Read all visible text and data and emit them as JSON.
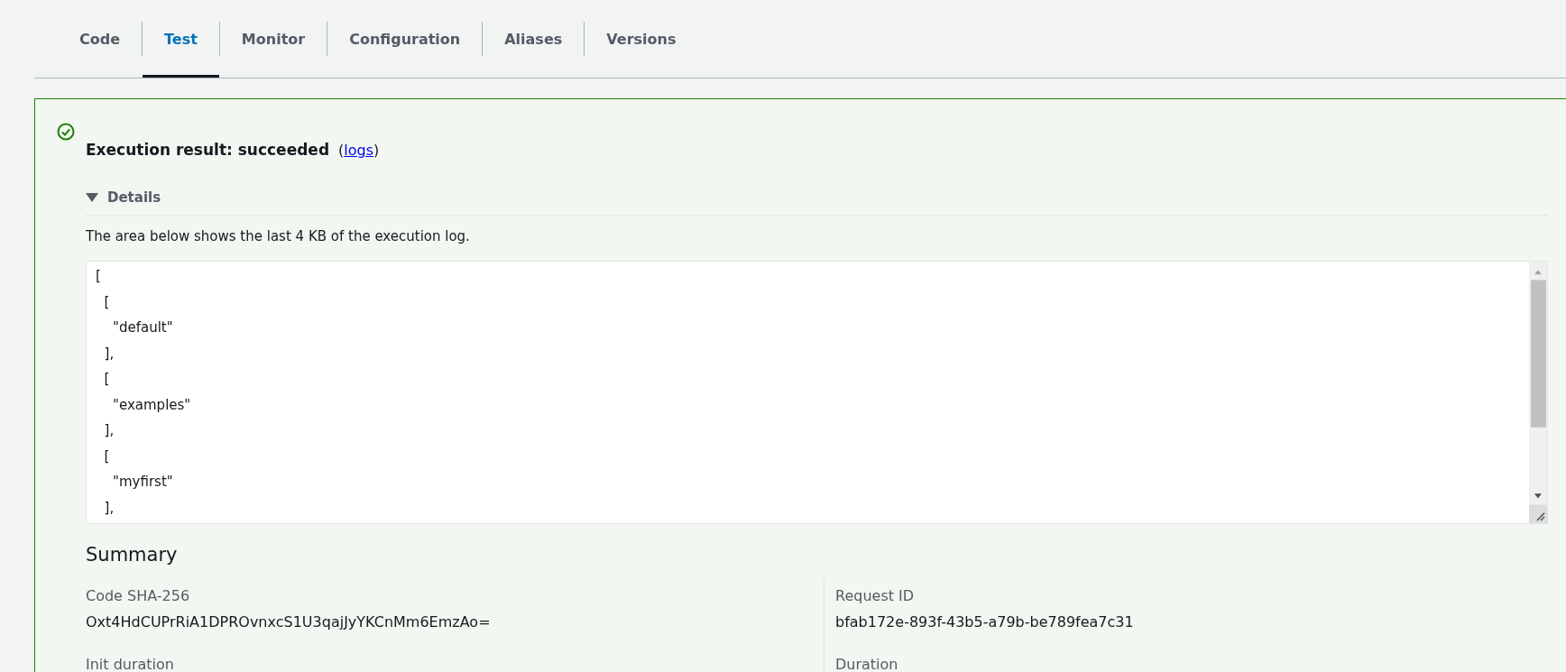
{
  "tabs": [
    {
      "label": "Code",
      "selected": false
    },
    {
      "label": "Test",
      "selected": true
    },
    {
      "label": "Monitor",
      "selected": false
    },
    {
      "label": "Configuration",
      "selected": false
    },
    {
      "label": "Aliases",
      "selected": false
    },
    {
      "label": "Versions",
      "selected": false
    }
  ],
  "result": {
    "succeeded": true,
    "title": "Execution result: succeeded",
    "link_open": "(",
    "link": "logs",
    "link_close": ")",
    "details": {
      "label": "Details",
      "expanded": true,
      "description": "The area below shows the last 4 KB of the execution log.",
      "log": "[\n  [\n    \"default\"\n  ],\n  [\n    \"examples\"\n  ],\n  [\n    \"myfirst\"\n  ],"
    }
  },
  "summary": {
    "title": "Summary",
    "fields": [
      {
        "label": "Code SHA-256",
        "value": "Oxt4HdCUPrRiA1DPROvnxcS1U3qajJyYKCnMm6EmzAo="
      },
      {
        "label": "Request ID",
        "value": "bfab172e-893f-43b5-a79b-be789fea7c31"
      },
      {
        "label": "Init duration"
      },
      {
        "label": "Duration"
      }
    ]
  }
}
